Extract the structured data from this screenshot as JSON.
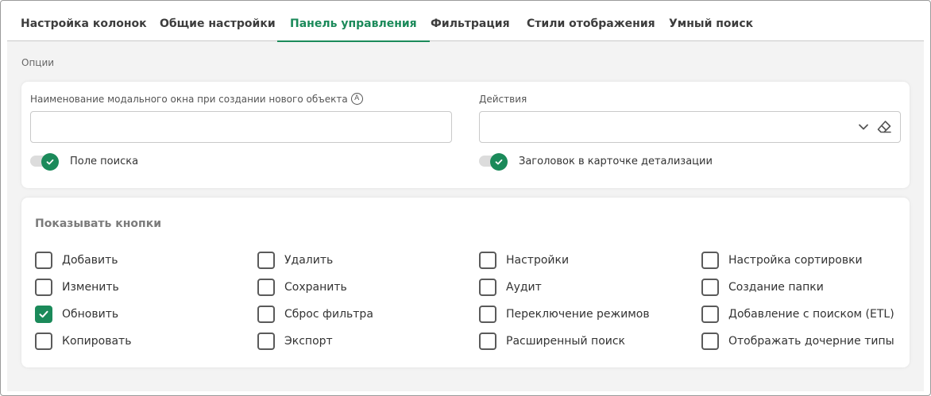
{
  "tabs": [
    {
      "label": "Настройка колонок",
      "active": false
    },
    {
      "label": "Общие настройки",
      "active": false
    },
    {
      "label": "Панель управления",
      "active": true
    },
    {
      "label": "Фильтрация",
      "active": false
    },
    {
      "label": "Стили отображения",
      "active": false
    },
    {
      "label": "Умный поиск",
      "active": false
    }
  ],
  "options_label": "Опции",
  "modal_name": {
    "label": "Наименование модального окна при создании нового объекта",
    "info_glyph": "A",
    "value": ""
  },
  "actions": {
    "label": "Действия",
    "value": ""
  },
  "toggles": {
    "search_field": {
      "label": "Поле поиска",
      "on": true
    },
    "detail_header": {
      "label": "Заголовок в карточке детализации",
      "on": true
    }
  },
  "buttons_group": {
    "title": "Показывать кнопки",
    "columns": [
      [
        {
          "label": "Добавить",
          "checked": false
        },
        {
          "label": "Изменить",
          "checked": false
        },
        {
          "label": "Обновить",
          "checked": true
        },
        {
          "label": "Копировать",
          "checked": false
        }
      ],
      [
        {
          "label": "Удалить",
          "checked": false
        },
        {
          "label": "Сохранить",
          "checked": false
        },
        {
          "label": "Сброс фильтра",
          "checked": false
        },
        {
          "label": "Экспорт",
          "checked": false
        }
      ],
      [
        {
          "label": "Настройки",
          "checked": false
        },
        {
          "label": "Аудит",
          "checked": false
        },
        {
          "label": "Переключение режимов",
          "checked": false
        },
        {
          "label": "Расширенный поиск",
          "checked": false
        }
      ],
      [
        {
          "label": "Настройка сортировки",
          "checked": false
        },
        {
          "label": "Создание папки",
          "checked": false
        },
        {
          "label": "Добавление с поиском (ETL)",
          "checked": false
        },
        {
          "label": "Отображать дочерние типы",
          "checked": false
        }
      ]
    ]
  },
  "colors": {
    "accent": "#1b8a5a",
    "border": "#c9c9c9",
    "background": "#f3f3f3"
  }
}
